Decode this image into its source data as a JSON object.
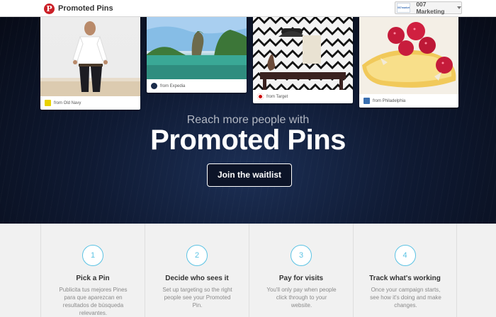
{
  "header": {
    "brand": "Promoted Pins",
    "account_name": "007 Marketing",
    "account_avatar_text": "007marketing"
  },
  "pins": [
    {
      "source": "from Old Navy",
      "icon_color": "#e8d200"
    },
    {
      "source": "from Expedia",
      "icon_color": "#1a2b4a"
    },
    {
      "source": "from Target",
      "icon_color": "#cc0000"
    },
    {
      "source": "from Philadelphia",
      "icon_color": "#3a6fb0"
    }
  ],
  "hero": {
    "subtitle": "Reach more people with",
    "title": "Promoted Pins",
    "cta": "Join the waitlist"
  },
  "steps": [
    {
      "number": "1",
      "title": "Pick a Pin",
      "text": "Publicita tus mejores Pines para que aparezcan en resultados de búsqueda relevantes."
    },
    {
      "number": "2",
      "title": "Decide who sees it",
      "text": "Set up targeting so the right people see your Promoted Pin."
    },
    {
      "number": "3",
      "title": "Pay for visits",
      "text": "You'll only pay when people click through to your website."
    },
    {
      "number": "4",
      "title": "Track what's working",
      "text": "Once your campaign starts, see how it's doing and make changes."
    }
  ],
  "colors": {
    "brand_red": "#cb2027",
    "accent_blue": "#5bc3e4",
    "hero_dark": "#0f1a33"
  }
}
